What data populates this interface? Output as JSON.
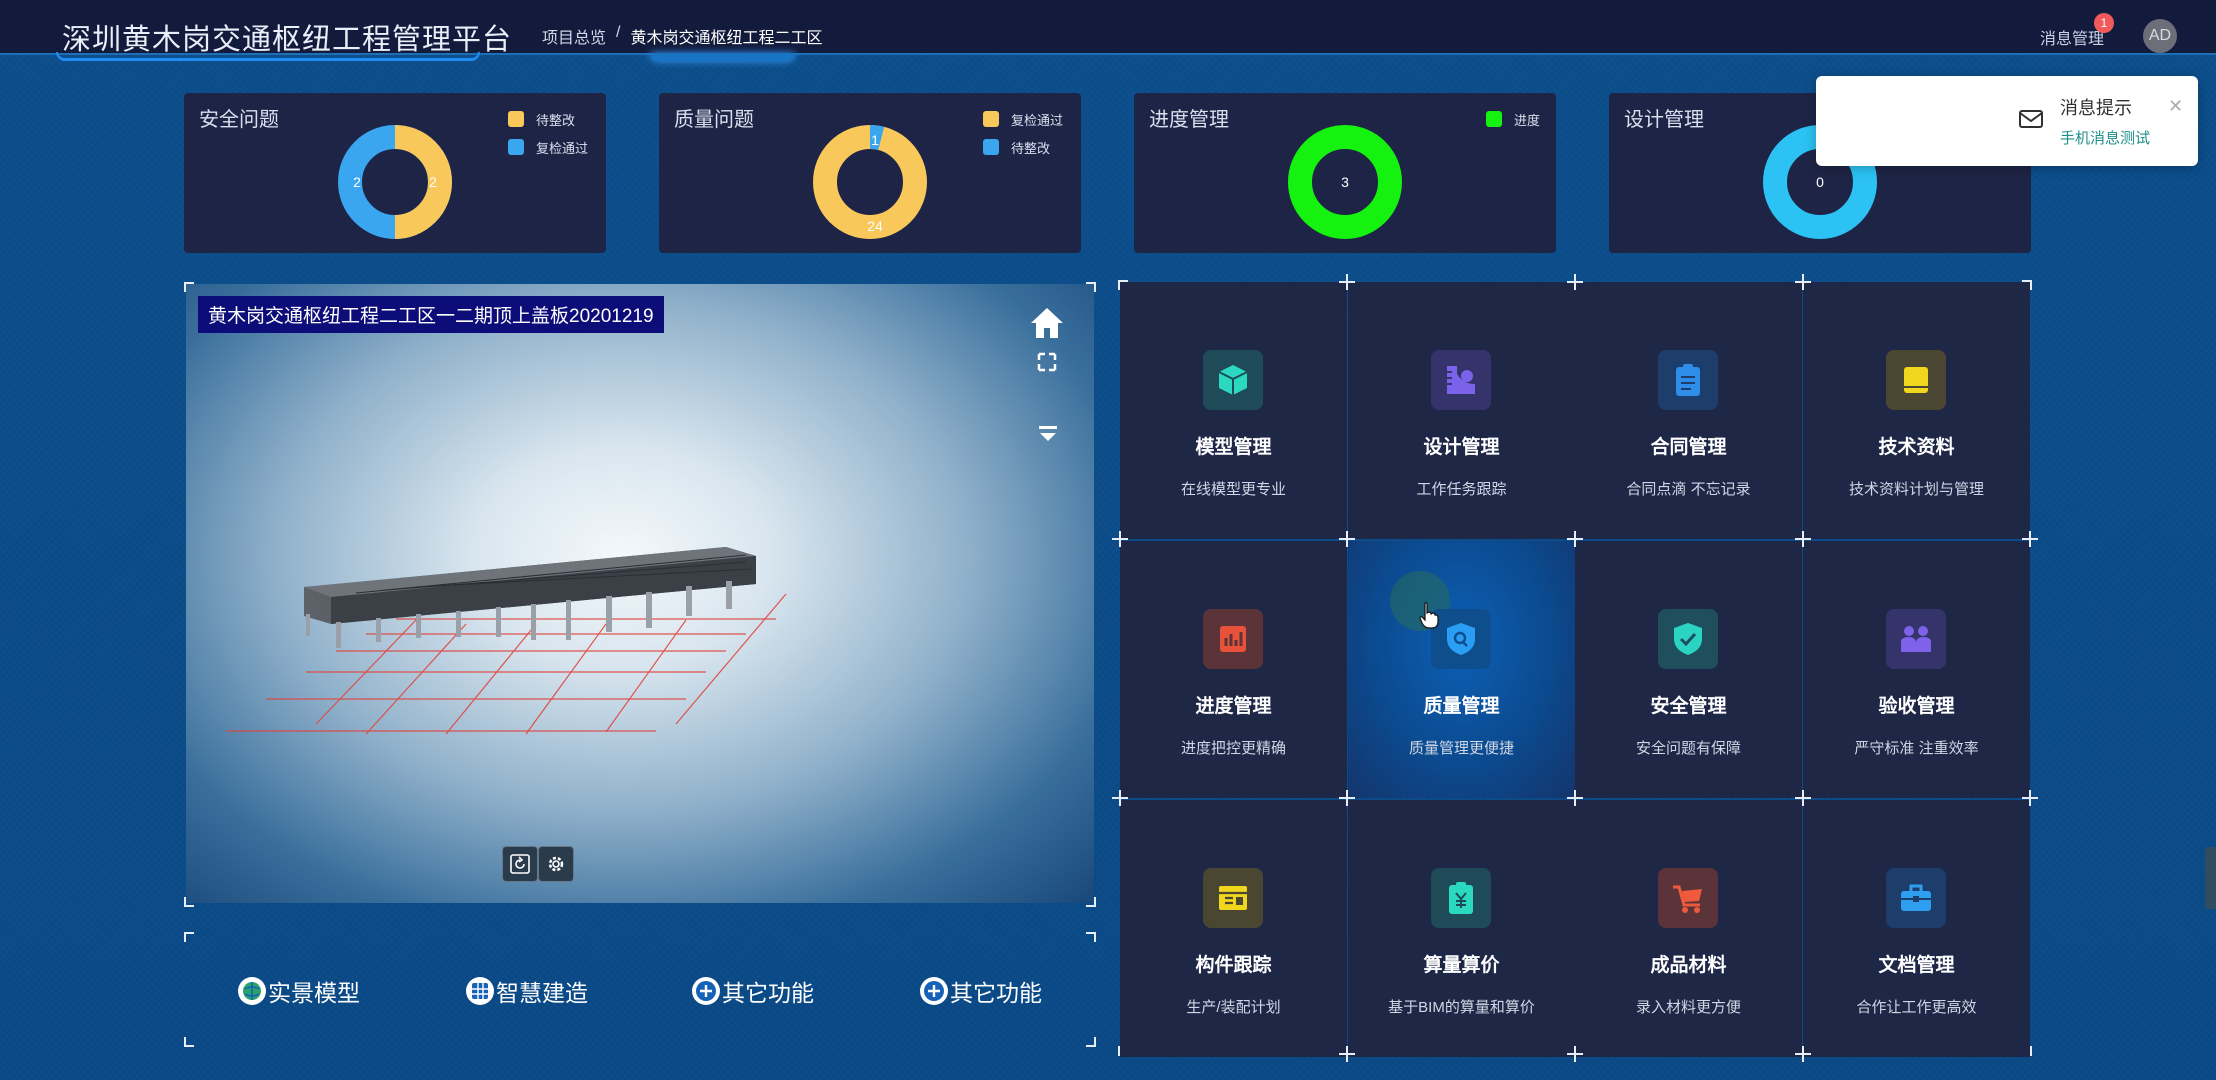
{
  "header": {
    "title": "深圳黄木岗交通枢纽工程管理平台",
    "breadcrumb": {
      "root": "项目总览",
      "sep": "/",
      "current": "黄木岗交通枢纽工程二工区"
    },
    "message_link": "消息管理",
    "message_badge": "1",
    "avatar": "AD"
  },
  "stat_cards": [
    {
      "title": "安全问题",
      "legend": [
        {
          "label": "待整改",
          "color": "#f9c85a"
        },
        {
          "label": "复检通过",
          "color": "#3aa6ef"
        }
      ],
      "slices": [
        {
          "value": 2,
          "color": "#f9c85a"
        },
        {
          "value": 2,
          "color": "#3aa6ef"
        }
      ]
    },
    {
      "title": "质量问题",
      "legend": [
        {
          "label": "复检通过",
          "color": "#f9c85a"
        },
        {
          "label": "待整改",
          "color": "#3aa6ef"
        }
      ],
      "slices": [
        {
          "value": 24,
          "color": "#f9c85a"
        },
        {
          "value": 1,
          "color": "#3aa6ef"
        }
      ]
    },
    {
      "title": "进度管理",
      "legend": [
        {
          "label": "进度",
          "color": "#16f20f"
        }
      ],
      "slices": [
        {
          "value": 3,
          "color": "#16f20f"
        }
      ]
    },
    {
      "title": "设计管理",
      "legend": [],
      "slices": [
        {
          "value": 0,
          "color": "#2cc3f4"
        }
      ]
    }
  ],
  "viewer": {
    "label": "黄木岗交通枢纽工程二工区一二期顶上盖板20201219",
    "icons": [
      "home-icon",
      "fullscreen-icon",
      "layers-menu-icon",
      "reset-view-icon",
      "settings-icon"
    ]
  },
  "bottom_tabs": [
    {
      "label": "实景模型",
      "icon": "globe-icon"
    },
    {
      "label": "智慧建造",
      "icon": "grid-icon"
    },
    {
      "label": "其它功能",
      "icon": "plus-icon"
    },
    {
      "label": "其它功能",
      "icon": "plus-icon"
    }
  ],
  "modules": [
    {
      "title": "模型管理",
      "subtitle": "在线模型更专业",
      "icon": "cube-icon",
      "color": "#2ad9c0",
      "bg": "#1f4a58"
    },
    {
      "title": "设计管理",
      "subtitle": "工作任务跟踪",
      "icon": "ruler-icon",
      "color": "#7b62ea",
      "bg": "#34336a"
    },
    {
      "title": "合同管理",
      "subtitle": "合同点滴 不忘记录",
      "icon": "clipboard-icon",
      "color": "#2d8de9",
      "bg": "#1d3e6a"
    },
    {
      "title": "技术资料",
      "subtitle": "技术资料计划与管理",
      "icon": "book-icon",
      "color": "#f1d61e",
      "bg": "#4a4632"
    },
    {
      "title": "进度管理",
      "subtitle": "进度把控更精确",
      "icon": "chart-icon",
      "color": "#e8523a",
      "bg": "#5a3438"
    },
    {
      "title": "质量管理",
      "subtitle": "质量管理更便捷",
      "icon": "shield-search-icon",
      "color": "#2a9df4",
      "bg": "#0f4e8c"
    },
    {
      "title": "安全管理",
      "subtitle": "安全问题有保障",
      "icon": "shield-check-icon",
      "color": "#2cd3c2",
      "bg": "#1f4e5c"
    },
    {
      "title": "验收管理",
      "subtitle": "严守标准 注重效率",
      "icon": "people-icon",
      "color": "#7e62ea",
      "bg": "#34336a"
    },
    {
      "title": "构件跟踪",
      "subtitle": "生产/装配计划",
      "icon": "panel-icon",
      "color": "#f1d61e",
      "bg": "#4a4632"
    },
    {
      "title": "算量算价",
      "subtitle": "基于BIM的算量和算价",
      "icon": "price-icon",
      "color": "#2ad9c0",
      "bg": "#1f4a58"
    },
    {
      "title": "成品材料",
      "subtitle": "录入材料更方便",
      "icon": "cart-icon",
      "color": "#ef5a3d",
      "bg": "#5a3438"
    },
    {
      "title": "文档管理",
      "subtitle": "合作让工作更高效",
      "icon": "briefcase-icon",
      "color": "#2e9ff0",
      "bg": "#1d3e6a"
    }
  ],
  "toast": {
    "title": "消息提示",
    "message": "手机消息测试"
  }
}
